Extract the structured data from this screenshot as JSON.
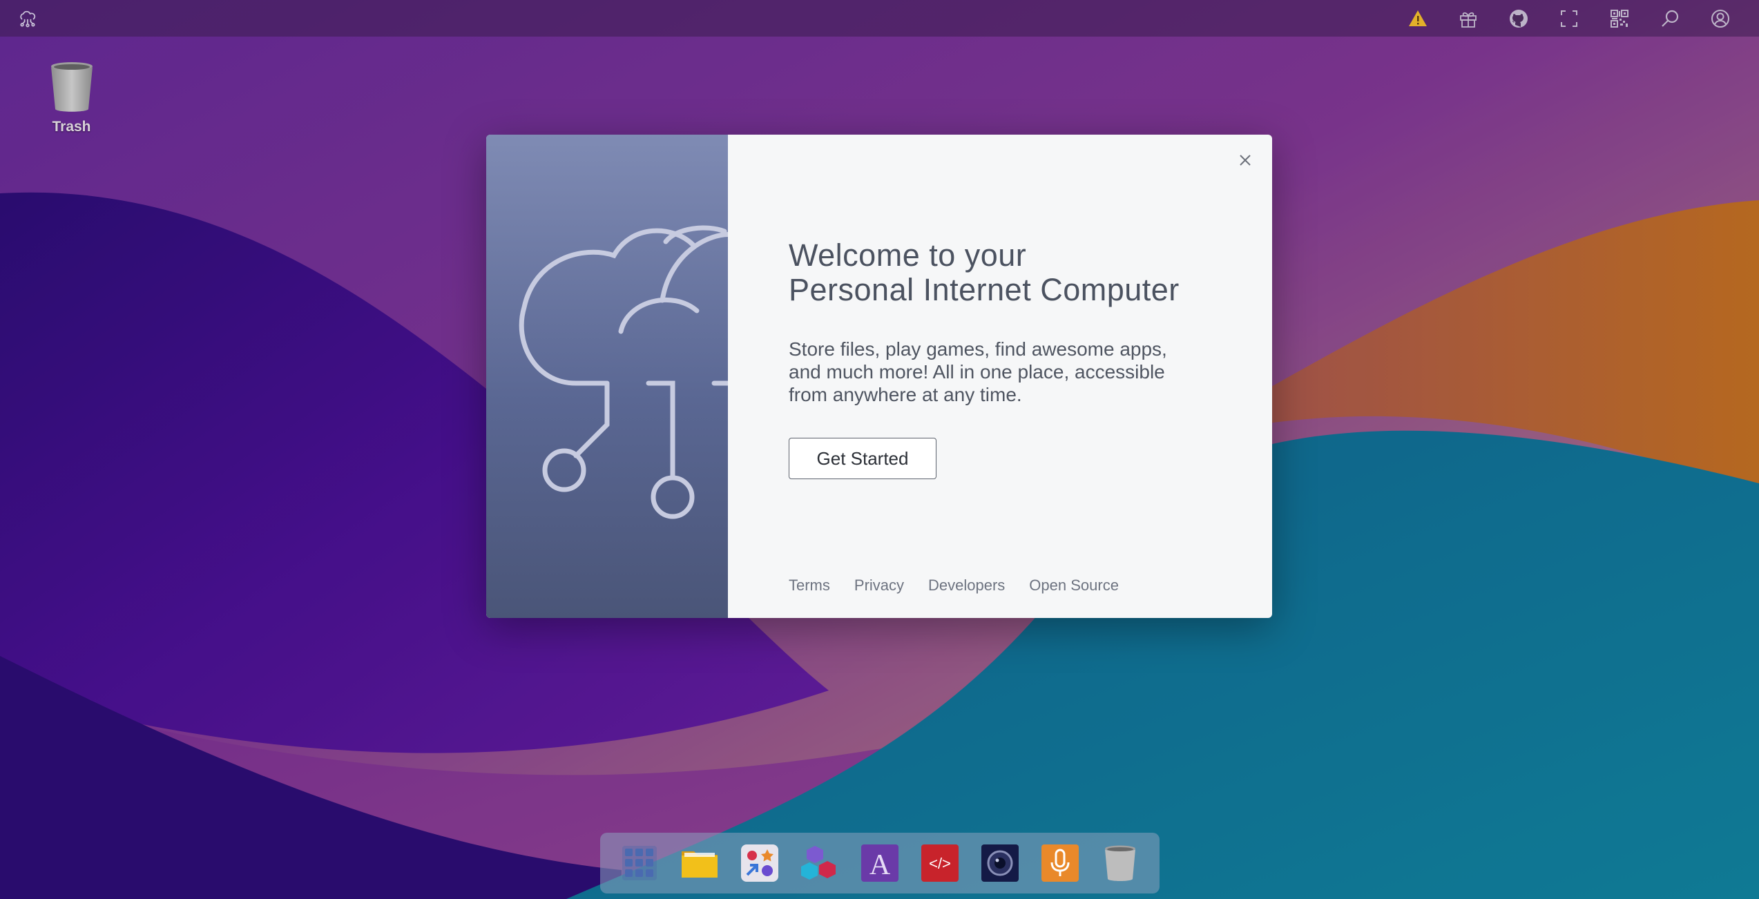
{
  "desktop": {
    "trash_label": "Trash"
  },
  "modal": {
    "title_line1": "Welcome to your",
    "title_line2": "Personal Internet Computer",
    "desc_line1": "Store files, play games, find awesome apps,",
    "desc_line2": "and much more! All in one place, accessible",
    "desc_line3": "from anywhere at any time.",
    "cta_label": "Get Started",
    "footer_links": [
      "Terms",
      "Privacy",
      "Developers",
      "Open Source"
    ]
  },
  "topbar": {
    "icons": [
      "cloud-logo-icon",
      "warning-icon",
      "gift-icon",
      "github-icon",
      "fullscreen-icon",
      "qr-code-icon",
      "search-icon",
      "user-account-icon"
    ]
  },
  "dock": {
    "apps": [
      "app-launcher",
      "files",
      "app-center",
      "dev-center",
      "font-editor",
      "code-editor",
      "camera",
      "recorder",
      "trash"
    ]
  },
  "colors": {
    "warning": "#e3b12a",
    "modal_bg": "#f6f7f8",
    "side_panel": "#6b7aa6",
    "code_editor": "#c8232b",
    "recorder": "#e9892a"
  }
}
